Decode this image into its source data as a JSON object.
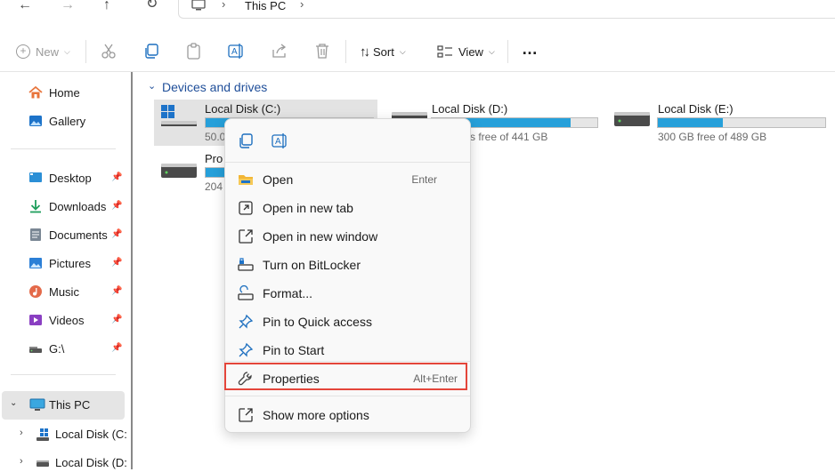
{
  "address": {
    "crumb": "This PC"
  },
  "toolbar": {
    "new_label": "New",
    "sort_label": "Sort",
    "view_label": "View",
    "more_label": "…"
  },
  "sidebar": {
    "items": [
      {
        "label": "Home"
      },
      {
        "label": "Gallery"
      },
      {
        "label": "Desktop"
      },
      {
        "label": "Downloads"
      },
      {
        "label": "Documents"
      },
      {
        "label": "Pictures"
      },
      {
        "label": "Music"
      },
      {
        "label": "Videos"
      },
      {
        "label": "G:\\"
      }
    ],
    "this_pc": "This PC",
    "children": [
      {
        "label": "Local Disk (C:"
      },
      {
        "label": "Local Disk (D:"
      }
    ]
  },
  "main": {
    "section": "Devices and drives",
    "drives": [
      {
        "name": "Local Disk (C:)",
        "free_text": "50.0",
        "used_fraction": 0.48
      },
      {
        "name": "Local Disk (D:)",
        "free_text": "s free of 441 GB",
        "used_fraction": 0.84
      },
      {
        "name": "Local Disk (E:)",
        "free_text": "300 GB free of 489 GB",
        "used_fraction": 0.39
      },
      {
        "name": "Pro",
        "free_text": "204",
        "used_fraction": 0.5
      }
    ]
  },
  "context_menu": {
    "items": [
      {
        "label": "Open",
        "shortcut": "Enter"
      },
      {
        "label": "Open in new tab",
        "shortcut": ""
      },
      {
        "label": "Open in new window",
        "shortcut": ""
      },
      {
        "label": "Turn on BitLocker",
        "shortcut": ""
      },
      {
        "label": "Format...",
        "shortcut": ""
      },
      {
        "label": "Pin to Quick access",
        "shortcut": ""
      },
      {
        "label": "Pin to Start",
        "shortcut": ""
      },
      {
        "label": "Properties",
        "shortcut": "Alt+Enter"
      },
      {
        "label": "Show more options",
        "shortcut": ""
      }
    ]
  },
  "colors": {
    "accent": "#26a0da",
    "highlight": "#e4453a",
    "section_title": "#1f4e99"
  }
}
